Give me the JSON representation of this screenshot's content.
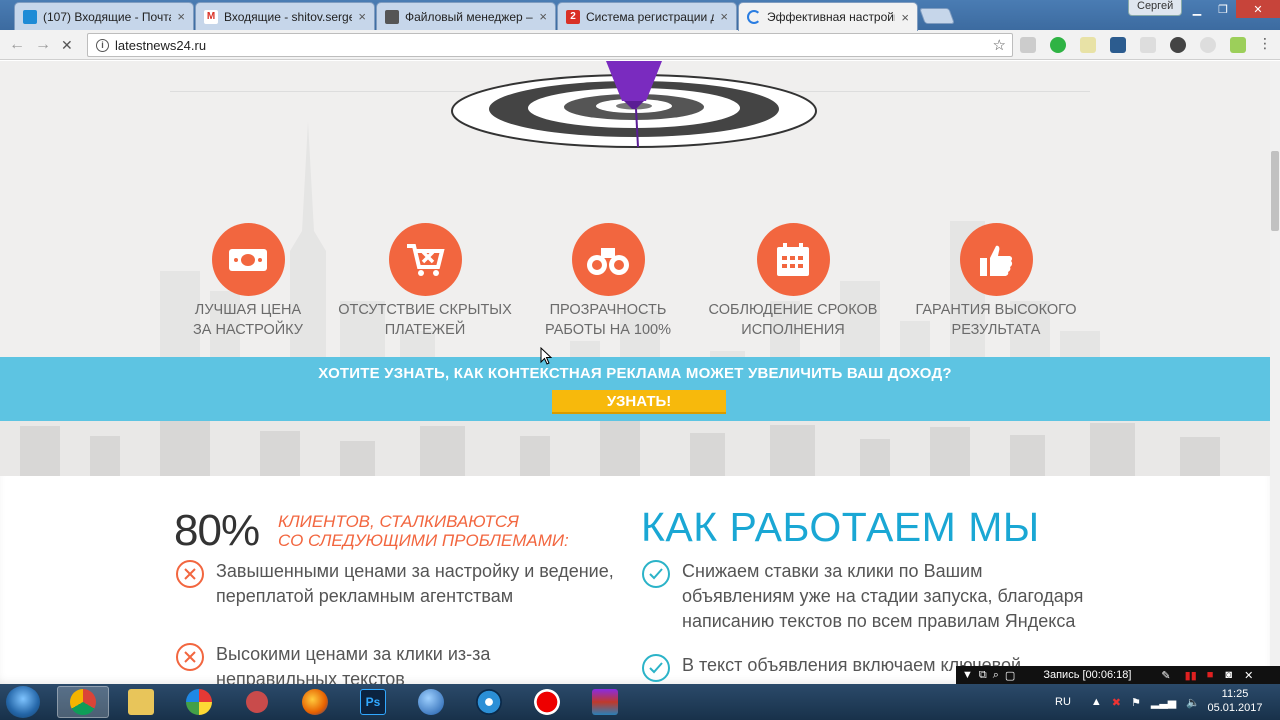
{
  "browser": {
    "tabs": [
      {
        "title": "(107) Входящие - Почта",
        "favicon_color": "#1e8bd6"
      },
      {
        "title": "Входящие - shitov.serge",
        "favicon_color": "#d93025",
        "favicon_letter": "M"
      },
      {
        "title": "Файловый менеджер –",
        "favicon_color": "#555555"
      },
      {
        "title": "Система регистрации д",
        "favicon_color": "#d93025",
        "favicon_letter": "2"
      },
      {
        "title": "Эффективная настройка",
        "favicon_color": "#2a7de1"
      }
    ],
    "tab_close": "×",
    "profile_name": "Сергей",
    "url": "latestnews24.ru",
    "back": "←",
    "forward": "→",
    "reload": "✕",
    "star": "☆"
  },
  "page": {
    "features": [
      {
        "label_line1": "Лучшая цена",
        "label_line2": "за настройку",
        "icon": "money-icon"
      },
      {
        "label_line1": "Отсутствие скрытых",
        "label_line2": "платежей",
        "icon": "cart-x-icon"
      },
      {
        "label_line1": "Прозрачность",
        "label_line2": "работы на 100%",
        "icon": "binoculars-icon"
      },
      {
        "label_line1": "Соблюдение сроков",
        "label_line2": "исполнения",
        "icon": "calendar-icon"
      },
      {
        "label_line1": "Гарантия высокого",
        "label_line2": "результата",
        "icon": "thumbs-up-icon"
      }
    ],
    "cta_text": "ХОТИТЕ УЗНАТЬ, КАК КОНТЕКСТНАЯ РЕКЛАМА МОЖЕТ УВЕЛИЧИТЬ ВАШ ДОХОД?",
    "cta_button": "УЗНАТЬ!",
    "percent": "80%",
    "problems_title_line1": "клиентов, сталкиваются",
    "problems_title_line2": "со следующими проблемами:",
    "problems": [
      {
        "line1": "Завышенными ценами за настройку и ведение,",
        "line2": "переплатой рекламным агентствам"
      },
      {
        "line1": "Высокими ценами за клики из-за",
        "line2": "неправильных текстов"
      }
    ],
    "how_title": "Как работаем мы",
    "solutions": [
      {
        "line1": "Снижаем ставки за клики по Вашим",
        "line2": "объявлениям уже на стадии запуска, благодаря",
        "line3": "написанию текстов по всем правилам Яндекса"
      },
      {
        "line1": "В текст объявления включаем ключевой"
      }
    ],
    "colors": {
      "accent_orange": "#f2663f",
      "accent_blue": "#1aa7d4",
      "cta_band": "#5dc4e2",
      "cta_button": "#f7b90c",
      "check_teal": "#2bb3c8"
    }
  },
  "recording": {
    "label": "Запись [00:06:18]"
  },
  "taskbar": {
    "lang": "RU",
    "time": "11:25",
    "date": "05.01.2017"
  }
}
